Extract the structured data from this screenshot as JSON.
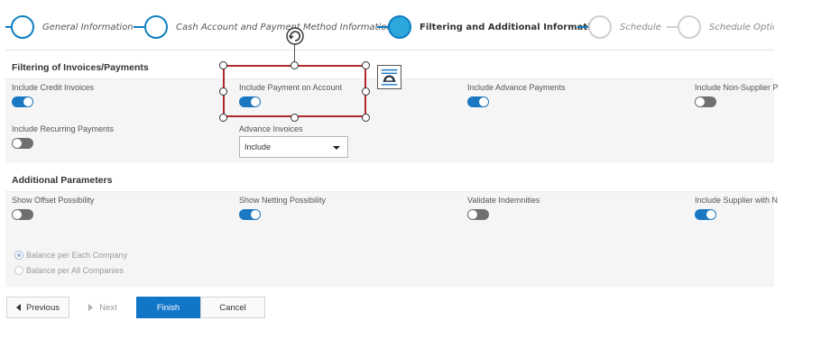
{
  "stepper": {
    "steps": [
      {
        "label": "General Information",
        "state": "done"
      },
      {
        "label": "Cash Account and Payment Method Information",
        "state": "done"
      },
      {
        "label": "Filtering and Additional Information",
        "state": "active"
      },
      {
        "label": "Schedule",
        "state": "future"
      },
      {
        "label": "Schedule Optic",
        "state": "future"
      }
    ]
  },
  "filtering": {
    "title": "Filtering of Invoices/Payments",
    "fields": [
      {
        "label": "Include Credit Invoices",
        "value": "on"
      },
      {
        "label": "Include Payment on Account",
        "value": "on"
      },
      {
        "label": "Include Advance Payments",
        "value": "on"
      },
      {
        "label": "Include Non-Supplier P",
        "value": "off"
      },
      {
        "label": "Include Recurring Payments",
        "value": "off"
      }
    ],
    "advance_invoices": {
      "label": "Advance Invoices",
      "value": "Include"
    }
  },
  "additional": {
    "title": "Additional Parameters",
    "fields": [
      {
        "label": "Show Offset Possibility",
        "value": "off"
      },
      {
        "label": "Show Netting Possibility",
        "value": "on"
      },
      {
        "label": "Validate Indemnities",
        "value": "off"
      },
      {
        "label": "Include Supplier with N",
        "value": "on"
      }
    ],
    "radios": [
      {
        "label": "Balance per Each Company",
        "checked": true
      },
      {
        "label": "Balance per All Companies",
        "checked": false
      }
    ]
  },
  "buttons": {
    "previous": "Previous",
    "next": "Next",
    "finish": "Finish",
    "cancel": "Cancel"
  },
  "colors": {
    "accent": "#1175c8",
    "selection_border": "#b3262b"
  }
}
